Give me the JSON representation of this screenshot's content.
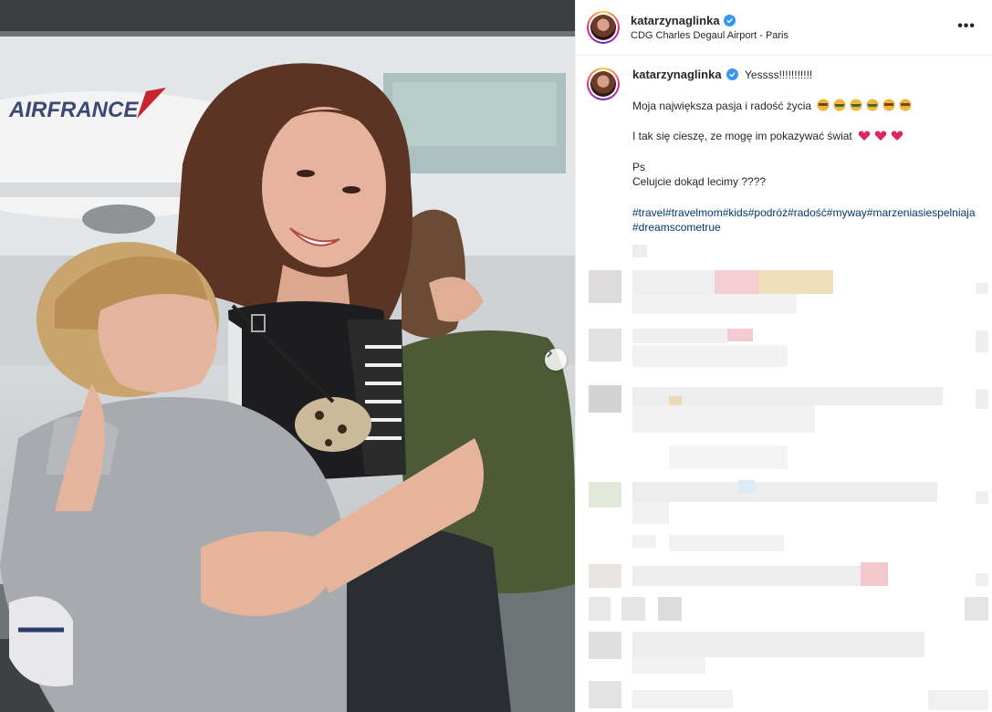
{
  "post": {
    "username": "katarzynaglinka",
    "location": "CDG Charles Degaul Airport - Paris",
    "more_label": "•••"
  },
  "caption": {
    "first_line": "Yessss!!!!!!!!!!!",
    "line2": "Moja największa pasja i radość życia",
    "line3": "I tak się cieszę, ze mogę im pokazywać świat",
    "line4": "Ps",
    "line5": "Celujcie dokąd lecimy ????",
    "hashtags": "#travel#travelmom#kids#podróż#radość#myway#marzeniasiespelniaja#dreamscometrue"
  },
  "photo": {
    "background_text": "AIRFRANCE"
  },
  "colors": {
    "verified": "#3897f0",
    "hashtag": "#00376b",
    "heart": "#e0245e"
  }
}
